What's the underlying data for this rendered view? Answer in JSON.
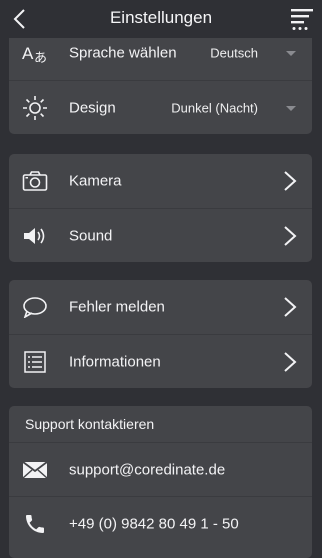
{
  "header": {
    "title": "Einstellungen",
    "back_icon": "chevron-left-icon",
    "menu_icon": "menu-icon"
  },
  "settings": {
    "language": {
      "label": "Sprache wählen",
      "value": "Deutsch",
      "icon": "language-icon"
    },
    "design": {
      "label": "Design",
      "value": "Dunkel (Nacht)",
      "icon": "sun-icon"
    }
  },
  "media": [
    {
      "label": "Kamera",
      "icon": "camera-icon"
    },
    {
      "label": "Sound",
      "icon": "speaker-icon"
    }
  ],
  "info": [
    {
      "label": "Fehler melden",
      "icon": "speech-bubble-icon"
    },
    {
      "label": "Informationen",
      "icon": "list-icon"
    }
  ],
  "support": {
    "title": "Support kontaktieren",
    "email": "support@coredinate.de",
    "phone": "+49 (0) 9842 80 49 1 - 50"
  },
  "colors": {
    "background": "#2f3035",
    "card": "#444549",
    "text": "#f2f2f4",
    "muted": "#8a8b90"
  }
}
